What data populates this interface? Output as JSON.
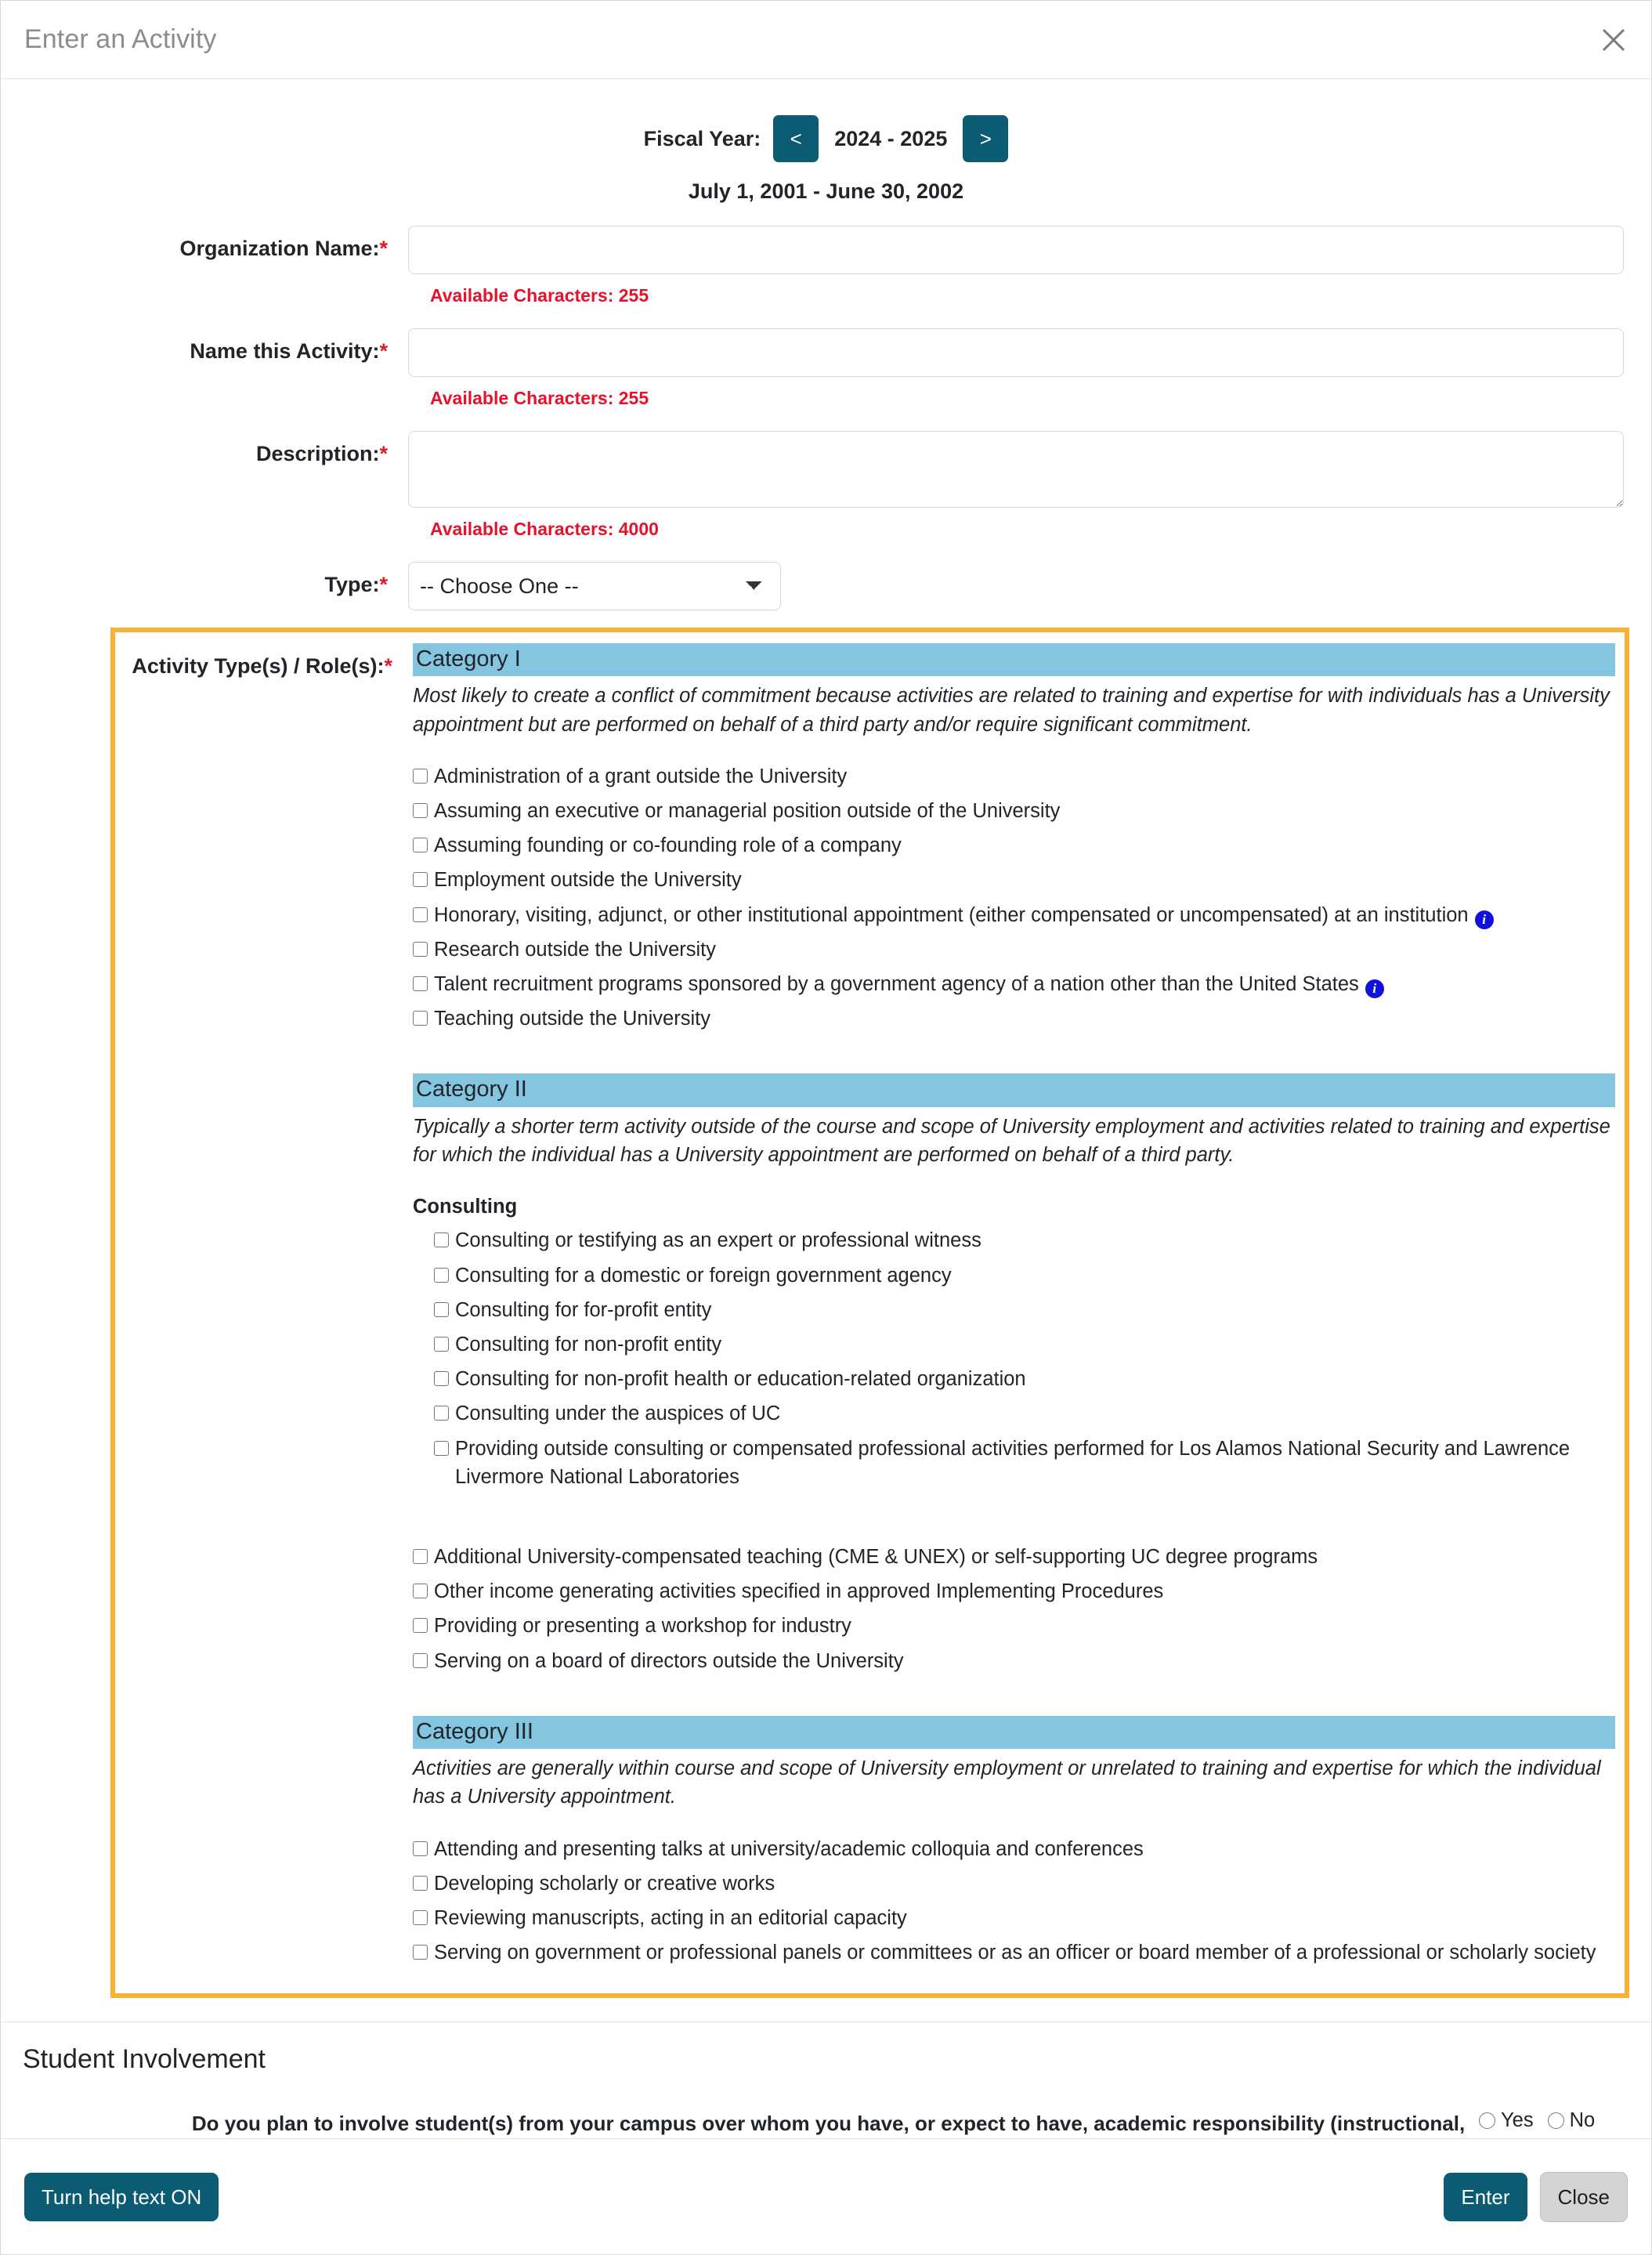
{
  "header": {
    "title": "Enter an Activity",
    "close_icon": "close-icon"
  },
  "fiscal_year": {
    "label": "Fiscal Year:",
    "prev_label": "<",
    "next_label": ">",
    "value": "2024 - 2025",
    "range": "July 1, 2001 - June 30, 2002"
  },
  "fields": {
    "organization_name": {
      "label": "Organization Name:",
      "required": "*",
      "value": "",
      "available": "Available Characters: 255"
    },
    "activity_name": {
      "label": "Name this Activity:",
      "required": "*",
      "value": "",
      "available": "Available Characters: 255"
    },
    "description": {
      "label": "Description:",
      "required": "*",
      "value": "",
      "available": "Available Characters: 4000"
    },
    "type": {
      "label": "Type:",
      "required": "*",
      "selected": "-- Choose One --"
    }
  },
  "activity_types": {
    "label": "Activity Type(s) / Role(s):",
    "required": "*",
    "categories": [
      {
        "title": "Category I",
        "description": "Most likely to create a conflict of commitment because activities are related to training and expertise for with individuals has a University appointment but are performed on behalf of a third party and/or require significant commitment.",
        "items": [
          {
            "label": "Administration of a grant outside the University",
            "info": false
          },
          {
            "label": "Assuming an executive or managerial position outside of the University",
            "info": false
          },
          {
            "label": "Assuming founding or co-founding role of a company",
            "info": false
          },
          {
            "label": "Employment outside the University",
            "info": false
          },
          {
            "label": "Honorary, visiting, adjunct, or other institutional appointment (either compensated or uncompensated) at an institution",
            "info": true
          },
          {
            "label": "Research outside the University",
            "info": false
          },
          {
            "label": "Talent recruitment programs sponsored by a government agency of a nation other than the United States",
            "info": true
          },
          {
            "label": "Teaching outside the University",
            "info": false
          }
        ]
      },
      {
        "title": "Category II",
        "description": "Typically a shorter term activity outside of the course and scope of University employment and activities related to training and expertise for which the individual has a University appointment are performed on behalf of a third party.",
        "subgroup_title": "Consulting",
        "subgroup_items": [
          {
            "label": "Consulting or testifying as an expert or professional witness",
            "info": false
          },
          {
            "label": "Consulting for a domestic or foreign government agency",
            "info": false
          },
          {
            "label": "Consulting for for-profit entity",
            "info": false
          },
          {
            "label": "Consulting for non-profit entity",
            "info": false
          },
          {
            "label": "Consulting for non-profit health or education-related organization",
            "info": false
          },
          {
            "label": "Consulting under the auspices of UC",
            "info": false
          },
          {
            "label": "Providing outside consulting or compensated professional activities performed for Los Alamos National Security and Lawrence Livermore National Laboratories",
            "info": false
          }
        ],
        "items": [
          {
            "label": "Additional University-compensated teaching (CME & UNEX) or self-supporting UC degree programs",
            "info": false
          },
          {
            "label": "Other income generating activities specified in approved Implementing Procedures",
            "info": false
          },
          {
            "label": "Providing or presenting a workshop for industry",
            "info": false
          },
          {
            "label": "Serving on a board of directors outside the University",
            "info": false
          }
        ]
      },
      {
        "title": "Category III",
        "description": "Activities are generally within course and scope of University employment or unrelated to training and expertise for which the individual has a University appointment.",
        "items": [
          {
            "label": "Attending and presenting talks at university/academic colloquia and conferences",
            "info": false
          },
          {
            "label": "Developing scholarly or creative works",
            "info": false
          },
          {
            "label": "Reviewing manuscripts, acting in an editorial capacity",
            "info": false
          },
          {
            "label": "Serving on government or professional panels or committees or as an officer or board member of a professional or scholarly society",
            "info": false
          }
        ]
      }
    ]
  },
  "student_involvement": {
    "title": "Student Involvement",
    "question": "Do you plan to involve student(s) from your campus over whom you have, or expect to have, academic responsibility (instructional, evaluative, and/or supervisory) in any substantive way - whether compensated or uncompensated - in this activity?",
    "required": "*",
    "yes_label": "Yes",
    "no_label": "No"
  },
  "footer": {
    "help_toggle": "Turn help text ON",
    "enter": "Enter",
    "close": "Close"
  },
  "colors": {
    "accent_teal": "#0b5c72",
    "highlight_orange": "#f9b233",
    "category_blue": "#84c5e0",
    "required_red": "#e01b24",
    "info_blue": "#1111dd"
  }
}
